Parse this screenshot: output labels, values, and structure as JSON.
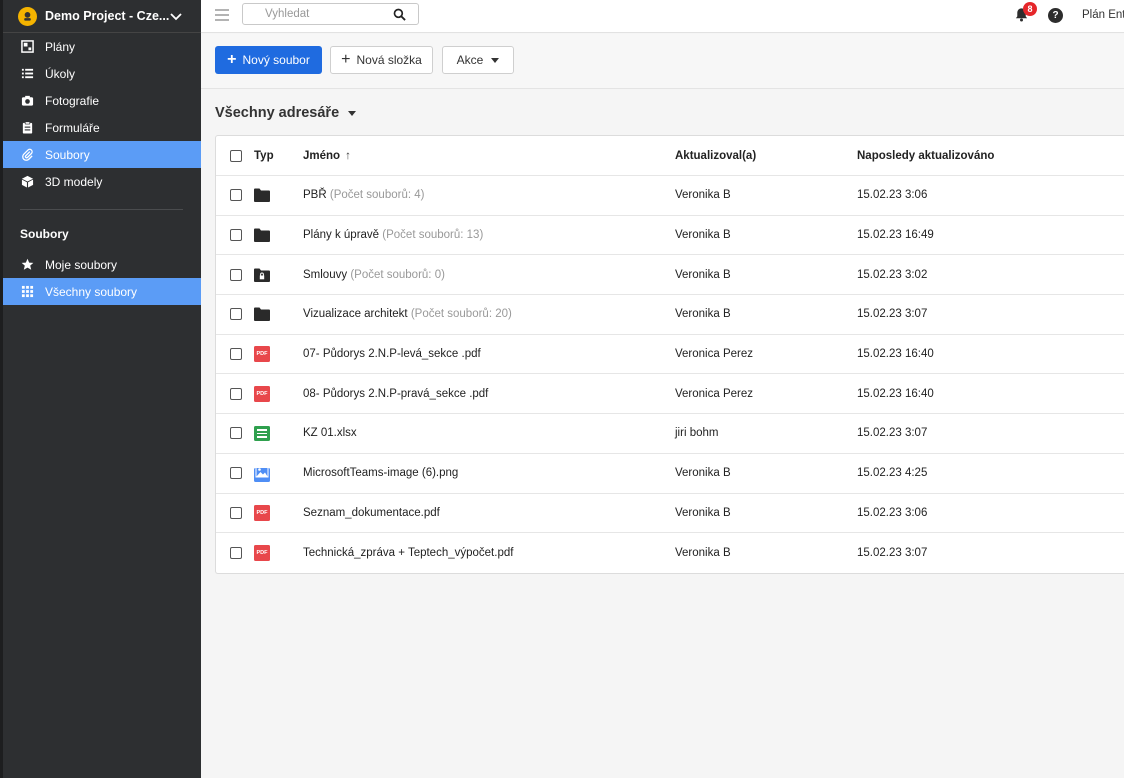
{
  "project": {
    "name": "Demo Project - Cze..."
  },
  "sidebar": {
    "items": [
      {
        "label": "Plány",
        "icon": "plans-icon"
      },
      {
        "label": "Úkoly",
        "icon": "tasks-icon"
      },
      {
        "label": "Fotografie",
        "icon": "camera-icon"
      },
      {
        "label": "Formuláře",
        "icon": "clipboard-icon"
      },
      {
        "label": "Soubory",
        "icon": "paperclip-icon"
      },
      {
        "label": "3D modely",
        "icon": "cube-icon"
      }
    ],
    "section_title": "Soubory",
    "sub_items": [
      {
        "label": "Moje soubory",
        "icon": "star-icon"
      },
      {
        "label": "Všechny soubory",
        "icon": "grid-icon"
      }
    ]
  },
  "topbar": {
    "search_placeholder": "Vyhledat",
    "notification_count": "8",
    "help": "?",
    "plan_label": "Plán Ent"
  },
  "toolbar": {
    "new_file": "Nový soubor",
    "new_folder": "Nová složka",
    "actions": "Akce"
  },
  "folder_heading": "Všechny adresáře",
  "table": {
    "headers": {
      "type": "Typ",
      "name": "Jméno",
      "updated_by": "Aktualizoval(a)",
      "updated_at": "Naposledy aktualizováno"
    },
    "rows": [
      {
        "type": "folder",
        "name": "PBŘ",
        "count": "(Počet souborů: 4)",
        "updated_by": "Veronika B",
        "updated_at": "15.02.23 3:06"
      },
      {
        "type": "folder",
        "name": "Plány k úpravě",
        "count": "(Počet souborů: 13)",
        "updated_by": "Veronika B",
        "updated_at": "15.02.23 16:49"
      },
      {
        "type": "locked-folder",
        "name": "Smlouvy",
        "count": "(Počet souborů: 0)",
        "updated_by": "Veronika B",
        "updated_at": "15.02.23 3:02"
      },
      {
        "type": "folder",
        "name": "Vizualizace architekt",
        "count": "(Počet souborů: 20)",
        "updated_by": "Veronika B",
        "updated_at": "15.02.23 3:07"
      },
      {
        "type": "pdf",
        "name": "07- Půdorys 2.N.P-levá_sekce .pdf",
        "count": "",
        "updated_by": "Veronica Perez",
        "updated_at": "15.02.23 16:40"
      },
      {
        "type": "pdf",
        "name": "08- Půdorys 2.N.P-pravá_sekce .pdf",
        "count": "",
        "updated_by": "Veronica Perez",
        "updated_at": "15.02.23 16:40"
      },
      {
        "type": "xlsx",
        "name": "KZ 01.xlsx",
        "count": "",
        "updated_by": "jiri bohm",
        "updated_at": "15.02.23 3:07"
      },
      {
        "type": "image",
        "name": "MicrosoftTeams-image (6).png",
        "count": "",
        "updated_by": "Veronika B",
        "updated_at": "15.02.23 4:25"
      },
      {
        "type": "pdf",
        "name": "Seznam_dokumentace.pdf",
        "count": "",
        "updated_by": "Veronika B",
        "updated_at": "15.02.23 3:06"
      },
      {
        "type": "pdf",
        "name": "Technická_zpráva + Teptech_výpočet.pdf",
        "count": "",
        "updated_by": "Veronika B",
        "updated_at": "15.02.23 3:07"
      }
    ]
  },
  "icons": {
    "pdf_label": "PDF"
  },
  "colors": {
    "sidebar": "#2d2f31",
    "active": "#5b9cf6",
    "primary": "#1f6be0",
    "badge": "#e5262a"
  }
}
